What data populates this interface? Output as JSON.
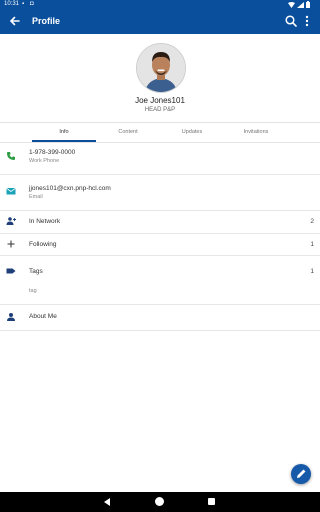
{
  "status_bar": {
    "time": "10:31"
  },
  "header": {
    "title": "Profile"
  },
  "profile": {
    "name": "Joe Jones101",
    "department": "HEAD P&P"
  },
  "tabs": [
    {
      "label": "Info",
      "active": true
    },
    {
      "label": "Content",
      "active": false
    },
    {
      "label": "Updates",
      "active": false
    },
    {
      "label": "Invitations",
      "active": false
    }
  ],
  "info": {
    "phone": {
      "value": "1-978-399-0000",
      "type": "Work Phone"
    },
    "email": {
      "value": "jjones101@cxn.pnp-hcl.com",
      "type": "Email"
    },
    "in_network": {
      "label": "In Network",
      "count": "2"
    },
    "following": {
      "label": "Following",
      "count": "1"
    },
    "tags": {
      "label": "Tags",
      "count": "1",
      "items": [
        "tag"
      ]
    },
    "about": {
      "label": "About Me"
    }
  },
  "colors": {
    "primary": "#0a4f9c",
    "phone_icon": "#2e9b45",
    "email_icon": "#1aa3b8"
  }
}
